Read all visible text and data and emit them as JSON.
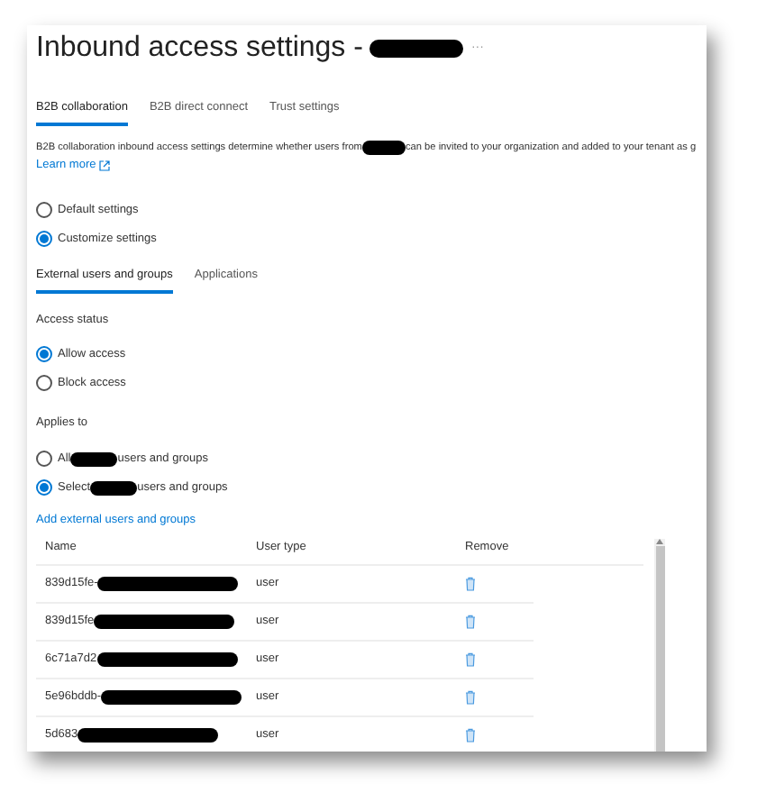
{
  "title": {
    "text": "Inbound access settings -",
    "redacted": true,
    "more": "···"
  },
  "tabs": [
    {
      "label": "B2B collaboration",
      "selected": true
    },
    {
      "label": "B2B direct connect",
      "selected": false
    },
    {
      "label": "Trust settings",
      "selected": false
    }
  ],
  "description": {
    "before": "B2B collaboration inbound access settings determine whether users from",
    "redacted": true,
    "after": "can be invited to your organization and added to your tenant as g",
    "link": "Learn more"
  },
  "settings_mode": [
    {
      "label": "Default settings",
      "selected": false
    },
    {
      "label": "Customize settings",
      "selected": true
    }
  ],
  "subtabs": [
    {
      "label": "External users and groups",
      "selected": true
    },
    {
      "label": "Applications",
      "selected": false
    }
  ],
  "access_status": {
    "heading": "Access status",
    "options": [
      {
        "label": "Allow access",
        "selected": true
      },
      {
        "label": "Block access",
        "selected": false
      }
    ]
  },
  "applies_to": {
    "heading": "Applies to",
    "options": [
      {
        "before": "All",
        "after": "users and groups",
        "redacted": true,
        "selected": false
      },
      {
        "before": "Select",
        "after": "users and groups",
        "redacted": true,
        "selected": true
      }
    ]
  },
  "add_link": "Add external users and groups",
  "table": {
    "columns": [
      "Name",
      "User type",
      "Remove"
    ],
    "rows": [
      {
        "name": "839d15fe-",
        "redacted": true,
        "type": "user"
      },
      {
        "name": "839d15fe",
        "redacted": true,
        "type": "user"
      },
      {
        "name": "6c71a7d2",
        "redacted": true,
        "type": "user"
      },
      {
        "name": "5e96bddb-",
        "redacted": true,
        "type": "user"
      },
      {
        "name": "5d683",
        "redacted": true,
        "type": "user"
      }
    ]
  }
}
